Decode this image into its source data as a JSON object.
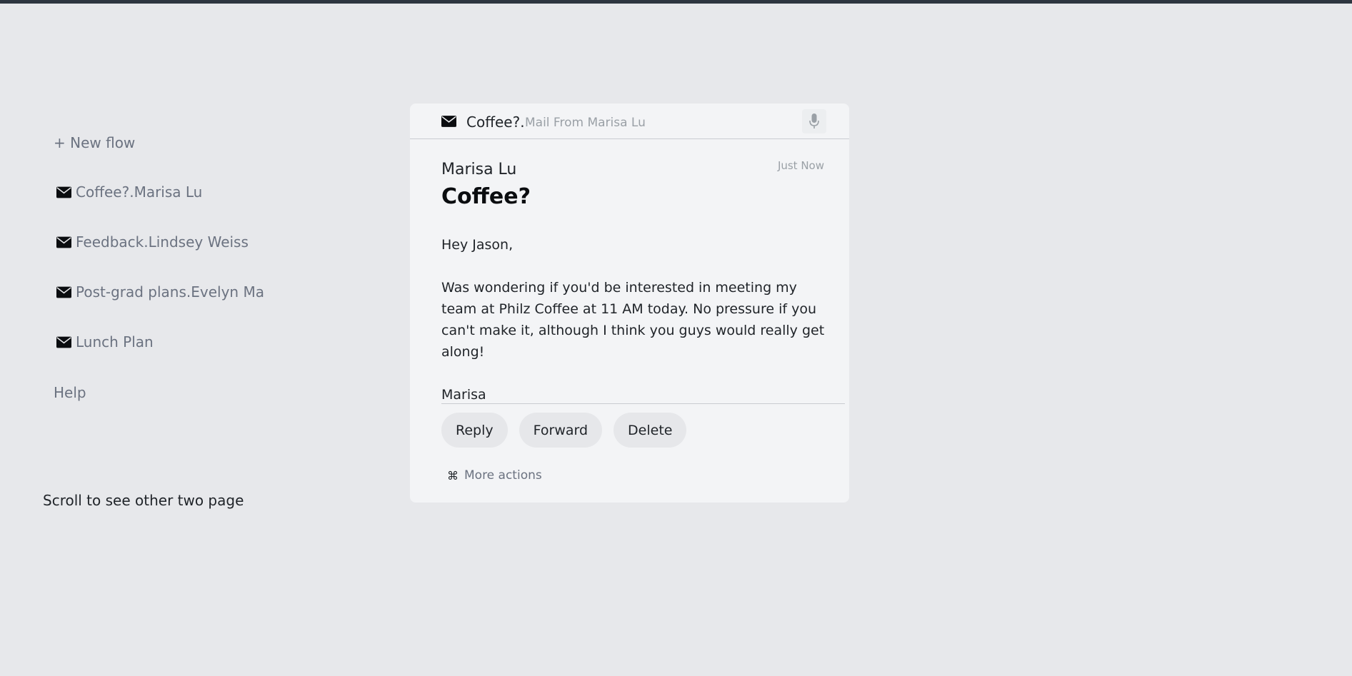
{
  "sidebar": {
    "new_flow": "+ New flow",
    "items": [
      {
        "label": "Coffee?.Marisa Lu",
        "icon": "envelope-icon"
      },
      {
        "label": "Feedback.Lindsey Weiss",
        "icon": "envelope-icon"
      },
      {
        "label": "Post-grad plans.Evelyn Ma",
        "icon": "envelope-icon"
      },
      {
        "label": "Lunch Plan",
        "icon": "envelope-icon"
      }
    ],
    "help": "Help",
    "scroll_hint": "Scroll to see other two page"
  },
  "card": {
    "header": {
      "icon": "envelope-icon",
      "subject": "Coffee?.",
      "from": "Mail From Marisa Lu",
      "mic_icon": "microphone-icon"
    },
    "sender": "Marisa Lu",
    "timestamp": "Just Now",
    "subject": "Coffee?",
    "body": {
      "greeting": "Hey Jason,",
      "paragraph": "Was wondering if you'd be interested in meeting my team at Philz Coffee at 11 AM today. No pressure if you can't make it, although I think you guys would really get along!",
      "signoff": "Marisa"
    },
    "actions": {
      "reply": "Reply",
      "forward": "Forward",
      "delete": "Delete"
    },
    "more_actions": {
      "icon": "⌘",
      "label": "More actions"
    }
  },
  "colors": {
    "background": "#e7e8eb",
    "top_bar": "#2e3640",
    "card": "#f3f4f6",
    "muted_text": "#6b7280",
    "button": "#e6e7ea"
  }
}
